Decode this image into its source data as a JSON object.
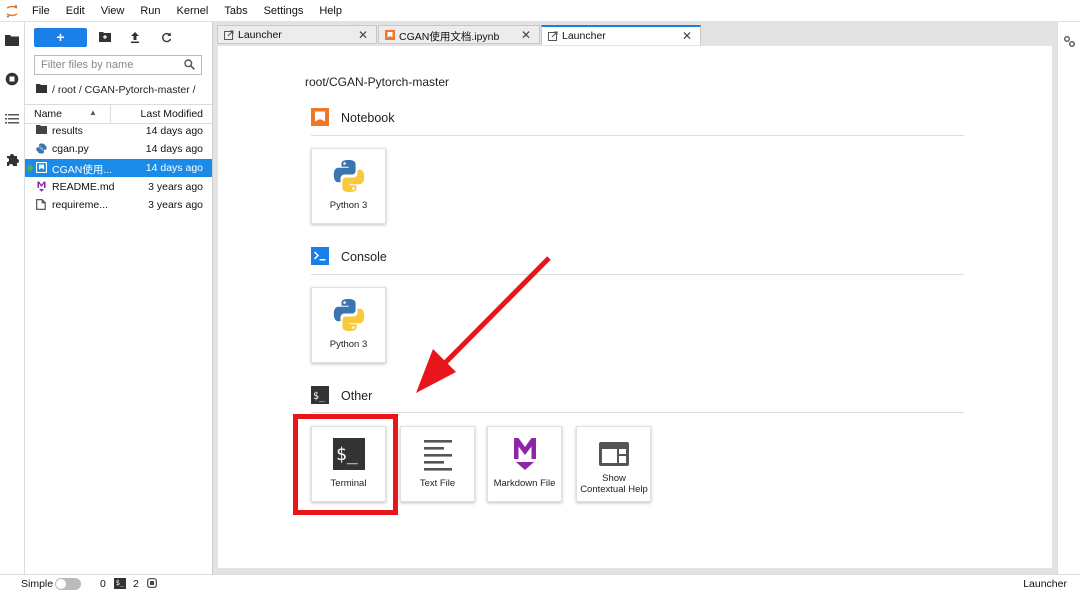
{
  "menu": [
    "File",
    "Edit",
    "View",
    "Run",
    "Kernel",
    "Tabs",
    "Settings",
    "Help"
  ],
  "activity_bar": [
    "folder-icon",
    "running-icon",
    "toc-icon",
    "extension-icon"
  ],
  "file_browser": {
    "new_label": "+",
    "filter_placeholder": "Filter files by name",
    "breadcrumb": "/ root / CGAN-Pytorch-master /",
    "columns": {
      "name": "Name",
      "sort_indicator": "▲",
      "modified": "Last Modified"
    },
    "files": [
      {
        "name": "results",
        "modified": "14 days ago",
        "icon": "folder-icon",
        "selected": false
      },
      {
        "name": "cgan.py",
        "modified": "14 days ago",
        "icon": "python-file-icon",
        "selected": false
      },
      {
        "name": "CGAN使用...",
        "modified": "14 days ago",
        "icon": "notebook-icon",
        "selected": true
      },
      {
        "name": "README.md",
        "modified": "3 years ago",
        "icon": "markdown-icon",
        "selected": false
      },
      {
        "name": "requireme...",
        "modified": "3 years ago",
        "icon": "file-icon",
        "selected": false
      }
    ]
  },
  "tabs": [
    {
      "label": "Launcher",
      "active": false
    },
    {
      "label": "CGAN使用文档.ipynb",
      "active": false
    },
    {
      "label": "Launcher",
      "active": true
    }
  ],
  "tab_close": "✕",
  "launcher": {
    "path": "root/CGAN-Pytorch-master",
    "sections": {
      "notebook": {
        "title": "Notebook",
        "cards": [
          {
            "label": "Python 3"
          }
        ]
      },
      "console": {
        "title": "Console",
        "cards": [
          {
            "label": "Python 3"
          }
        ]
      },
      "other": {
        "title": "Other",
        "cards": [
          {
            "label": "Terminal"
          },
          {
            "label": "Text File"
          },
          {
            "label": "Markdown File"
          },
          {
            "label": "Show Contextual Help"
          }
        ]
      }
    }
  },
  "annotation": {
    "color": "#e8151b"
  },
  "status": {
    "simple_label": "Simple",
    "kernels": "0",
    "terminal_glyph": "$_",
    "terminals": "2",
    "right": "Launcher"
  },
  "colors": {
    "accent": "#1a7fe6",
    "selection": "#1a8ce8",
    "notebook_orange": "#f37626",
    "markdown_purple": "#7b1fa2"
  }
}
